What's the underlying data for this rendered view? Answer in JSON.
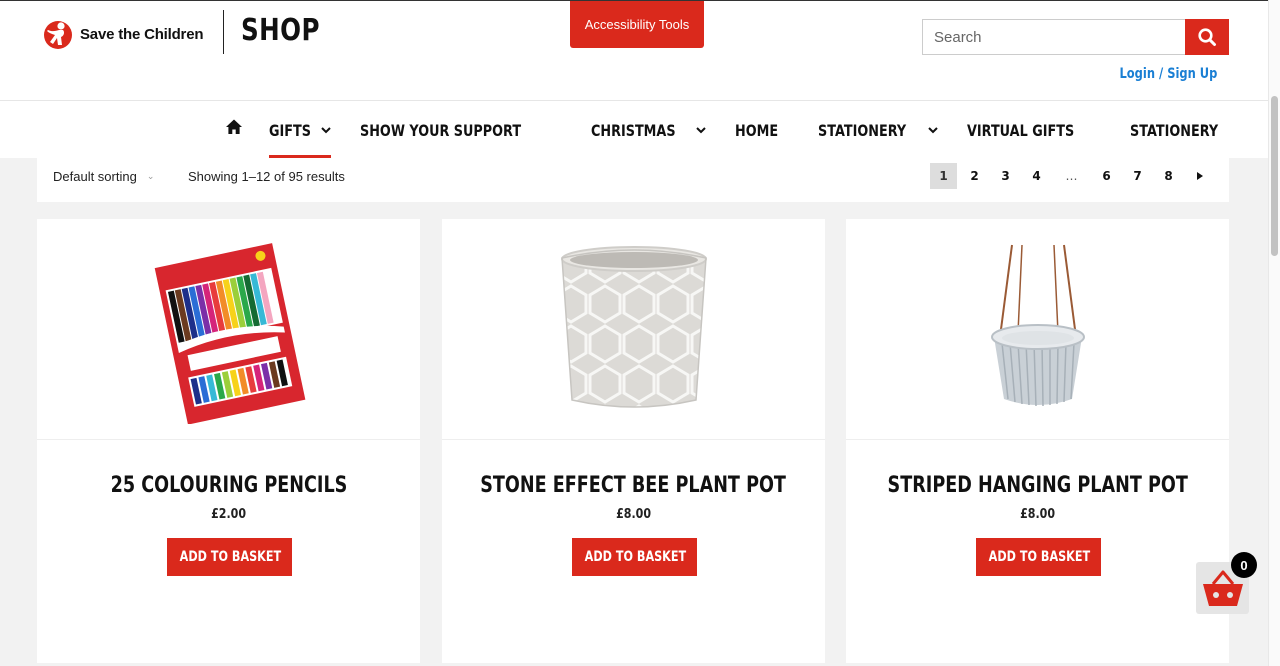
{
  "header": {
    "brand": "Save the Children",
    "shop_title": "SHOP",
    "accessibility_button": "Accessibility Tools",
    "search_placeholder": "Search",
    "login": "Login / Sign Up"
  },
  "nav": {
    "items": [
      {
        "label": "GIFTS",
        "dropdown": true,
        "active": true
      },
      {
        "label": "SHOW YOUR SUPPORT",
        "dropdown": false
      },
      {
        "label": "CHRISTMAS",
        "dropdown": true
      },
      {
        "label": "HOME",
        "dropdown": false
      },
      {
        "label": "STATIONERY",
        "dropdown": true
      },
      {
        "label": "VIRTUAL GIFTS",
        "dropdown": false
      },
      {
        "label": "STATIONERY",
        "dropdown": false
      }
    ]
  },
  "toolbar": {
    "sort_label": "Default sorting",
    "results_text": "Showing 1–12 of 95 results",
    "pages": [
      "1",
      "2",
      "3",
      "4",
      "…",
      "6",
      "7",
      "8"
    ],
    "current_page": "1",
    "next_icon": "caret-right-icon"
  },
  "products": [
    {
      "title": "25 COLOURING PENCILS",
      "price": "£2.00",
      "button": "ADD TO BASKET"
    },
    {
      "title": "STONE EFFECT BEE PLANT POT",
      "price": "£8.00",
      "button": "ADD TO BASKET"
    },
    {
      "title": "STRIPED HANGING PLANT POT",
      "price": "£8.00",
      "button": "ADD TO BASKET"
    }
  ],
  "basket": {
    "count": "0",
    "icon": "basket-icon"
  },
  "colors": {
    "accent": "#da291c",
    "link": "#1a7fd4",
    "background": "#f2f2f2"
  }
}
